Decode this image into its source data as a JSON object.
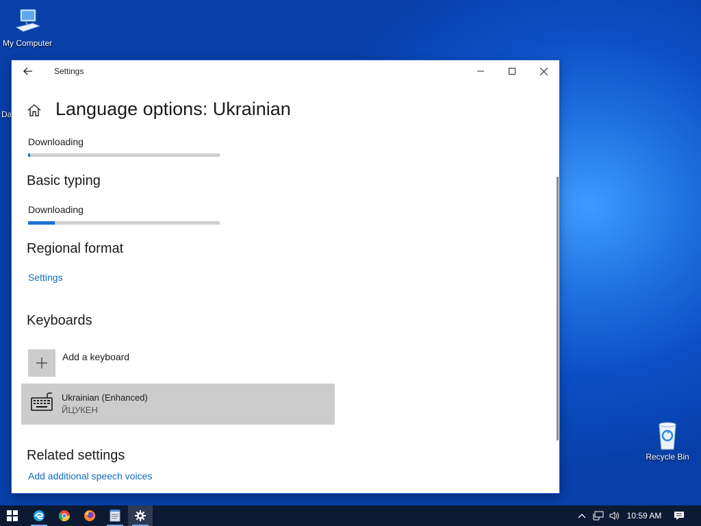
{
  "desktop": {
    "my_computer_label": "My Computer",
    "partial_label": "Da",
    "recycle_bin_label": "Recycle Bin"
  },
  "window": {
    "title": "Settings",
    "page_title": "Language options: Ukrainian"
  },
  "sections": {
    "download1": {
      "label": "Downloading",
      "progress": 0.01
    },
    "basic_typing": {
      "heading": "Basic typing",
      "status": "Downloading",
      "progress": 0.14
    },
    "regional_format": {
      "heading": "Regional format",
      "link": "Settings"
    },
    "keyboards": {
      "heading": "Keyboards",
      "add_label": "Add a keyboard",
      "items": [
        {
          "name": "Ukrainian (Enhanced)",
          "layout": "ЙЦУКЕН"
        }
      ]
    },
    "related": {
      "heading": "Related settings",
      "link": "Add additional speech voices"
    }
  },
  "taskbar": {
    "apps": [
      "start-icon",
      "edge-icon",
      "chrome-icon",
      "firefox-icon",
      "notepad-icon",
      "settings-icon"
    ],
    "clock": "10:59 AM"
  },
  "colors": {
    "accent": "#1a73d1",
    "link": "#0b6bbf",
    "taskbar": "#0c1a33"
  }
}
